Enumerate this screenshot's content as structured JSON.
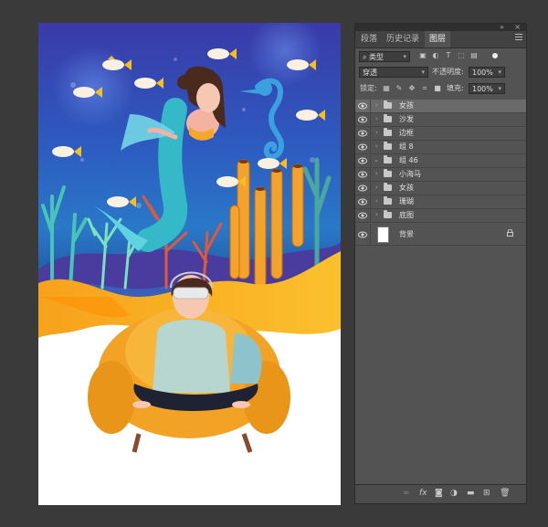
{
  "panel": {
    "tabs": [
      {
        "label": "段落"
      },
      {
        "label": "历史记录"
      },
      {
        "label": "图层"
      }
    ],
    "filter": {
      "kind_label": "类型"
    },
    "blend_mode": "穿透",
    "opacity": {
      "label": "不透明度:",
      "value": "100%"
    },
    "lock": {
      "label": "锁定:"
    },
    "fill": {
      "label": "填充:",
      "value": "100%"
    },
    "layers": [
      {
        "name": "女孩",
        "type": "group",
        "selected": true
      },
      {
        "name": "沙发",
        "type": "group"
      },
      {
        "name": "边框",
        "type": "group"
      },
      {
        "name": "组 8",
        "type": "group"
      },
      {
        "name": "组 46",
        "type": "group",
        "expanded": true
      },
      {
        "name": "小海马",
        "type": "group"
      },
      {
        "name": "女孩",
        "type": "group"
      },
      {
        "name": "珊瑚",
        "type": "group"
      },
      {
        "name": "底图",
        "type": "group"
      },
      {
        "name": "背景",
        "type": "background",
        "locked": true
      }
    ],
    "bottom_icons": [
      "link-icon",
      "fx-icon",
      "mask-icon",
      "adjustment-icon",
      "new-group-icon",
      "new-layer-icon",
      "trash-icon"
    ],
    "bottom_fx_label": "fx"
  },
  "colors": {
    "workspace": "#3a3a3a",
    "panel": "#535353",
    "selected_layer": "#6a6a6a"
  }
}
